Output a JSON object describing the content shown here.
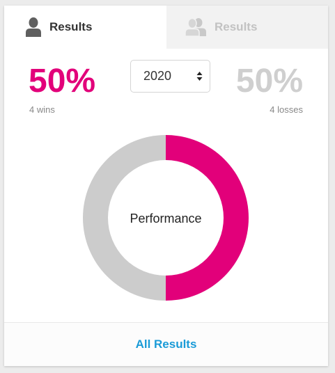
{
  "tabs": [
    {
      "label": "Results",
      "icon": "user-icon",
      "active": true
    },
    {
      "label": "Results",
      "icon": "users-icon",
      "active": false
    }
  ],
  "stats": {
    "win_percent": "50%",
    "win_count": "4 wins",
    "loss_percent": "50%",
    "loss_count": "4 losses"
  },
  "year_select": {
    "value": "2020"
  },
  "chart_data": {
    "type": "pie",
    "center_label": "Performance",
    "slices": [
      {
        "label": "Wins",
        "value": 4,
        "color": "#e2007a"
      },
      {
        "label": "Losses",
        "value": 4,
        "color": "#cccccc"
      }
    ]
  },
  "footer": {
    "link_label": "All Results"
  },
  "colors": {
    "accent": "#e2007a",
    "muted": "#cccccc",
    "link": "#1a9bd7"
  }
}
